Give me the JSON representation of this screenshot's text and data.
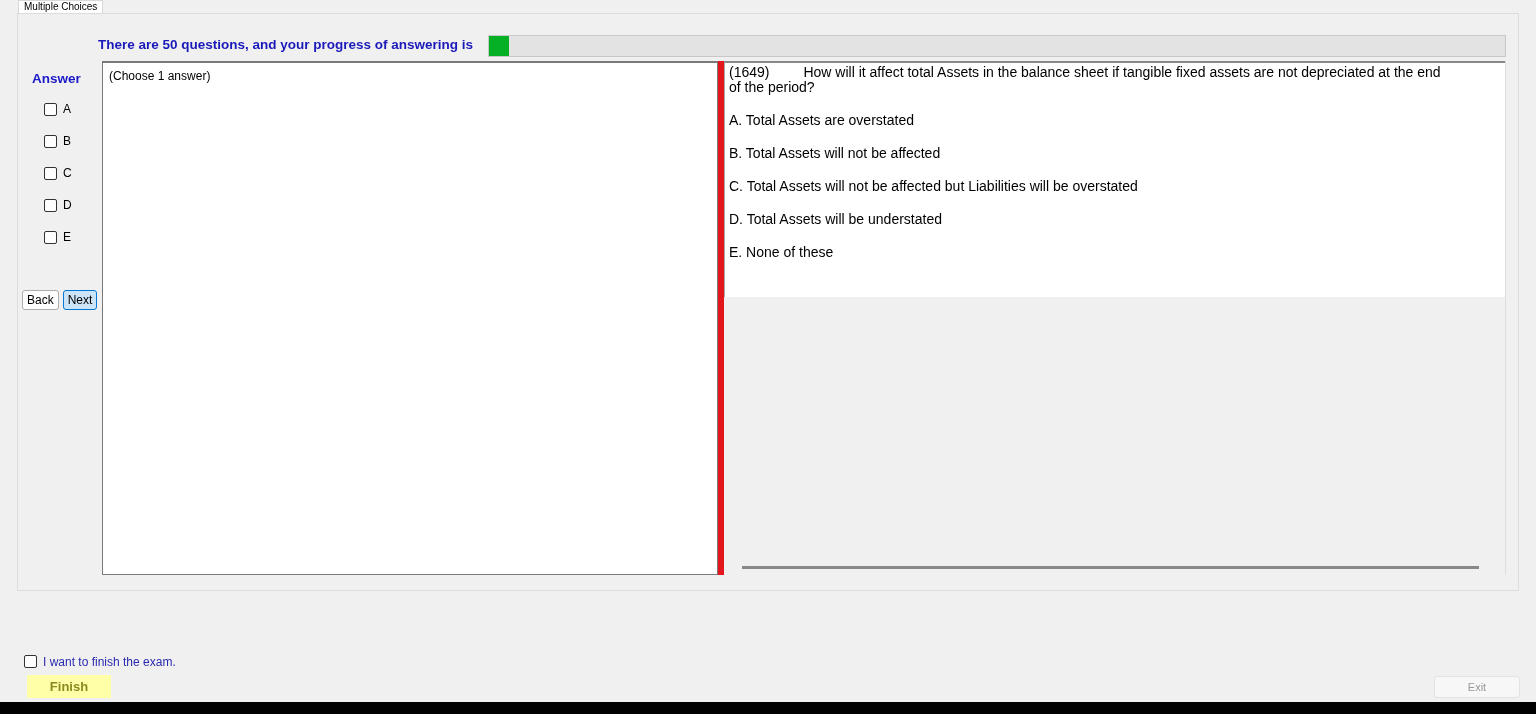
{
  "tab": {
    "label": "Multiple Choices",
    "selected": true
  },
  "progress": {
    "text": "There are 50 questions, and your progress of answering is",
    "level": 0.02
  },
  "answer": {
    "title": "Answer",
    "options": [
      {
        "label": "A",
        "checked": false
      },
      {
        "label": "B",
        "checked": false
      },
      {
        "label": "C",
        "checked": false
      },
      {
        "label": "D",
        "checked": false
      },
      {
        "label": "E",
        "checked": false
      }
    ]
  },
  "nav_buttons": [
    {
      "label": "Back",
      "selected": false
    },
    {
      "label": "Next",
      "selected": true
    }
  ],
  "answer_box": {
    "text": "(Choose 1 answer)"
  },
  "question": {
    "number": "(1649)",
    "text": "How will it affect total Assets in the balance sheet if tangible fixed assets are not depreciated at the end of the period?",
    "choices": [
      "A.  Total Assets are overstated",
      "B.  Total Assets will not be affected",
      "C.  Total Assets will not be affected but Liabilities will be overstated",
      "D.  Total Assets will be understated",
      "E.  None of these"
    ]
  },
  "finish": {
    "checkbox_label": "I want to finish the exam.",
    "checked": false,
    "button": "Finish"
  },
  "exit": {
    "label": "Exit",
    "disabled": true
  }
}
